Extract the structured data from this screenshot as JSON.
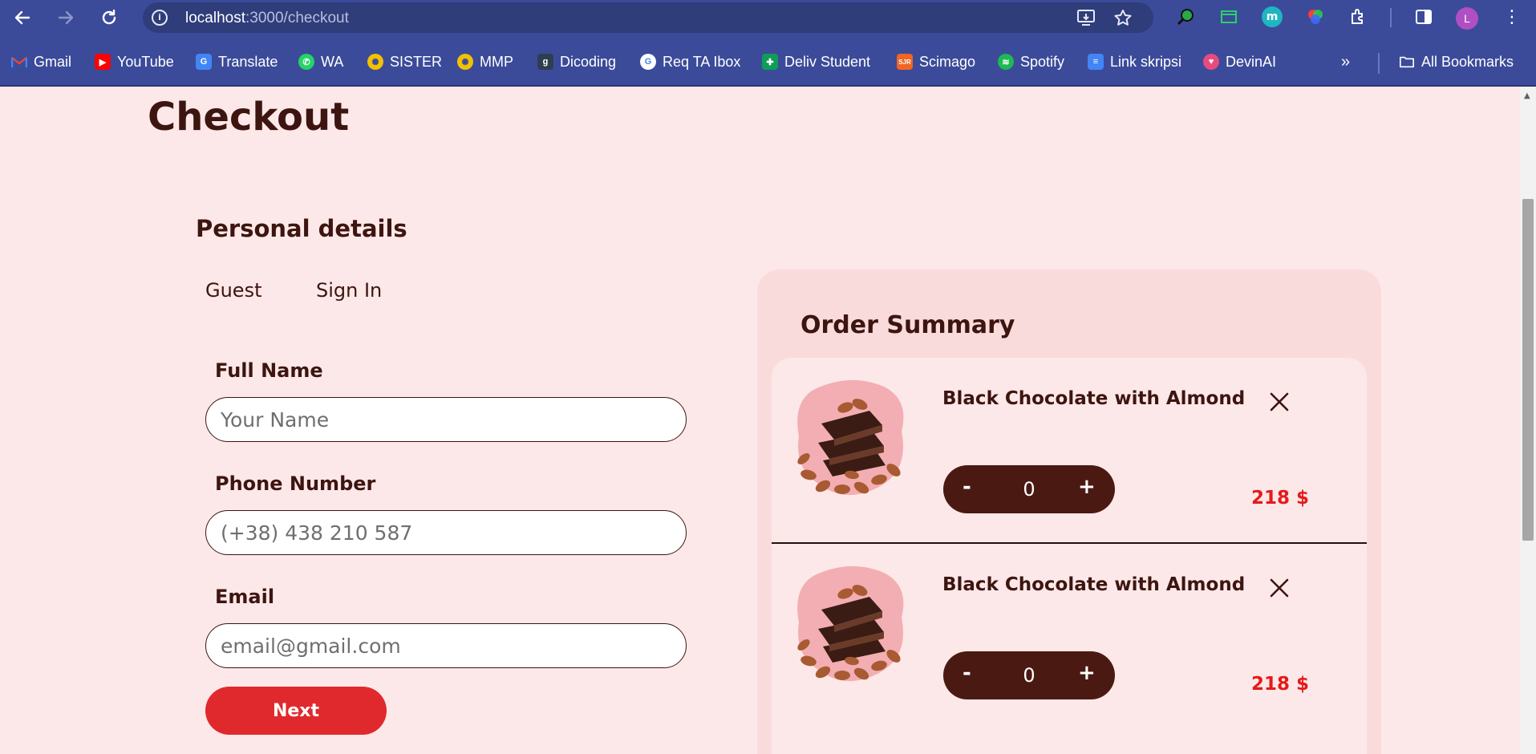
{
  "browser": {
    "url_host": "localhost",
    "url_path": ":3000/checkout",
    "avatar_letter": "L",
    "bookmarks": [
      {
        "label": "Gmail",
        "icon": "gmail-icon",
        "color": "#ea4335"
      },
      {
        "label": "YouTube",
        "icon": "youtube-icon",
        "color": "#ff0000"
      },
      {
        "label": "Translate",
        "icon": "translate-icon",
        "color": "#4285f4"
      },
      {
        "label": "WA",
        "icon": "whatsapp-icon",
        "color": "#25d366"
      },
      {
        "label": "SISTER",
        "icon": "sister-icon",
        "color": "#f2c200"
      },
      {
        "label": "MMP",
        "icon": "mmp-icon",
        "color": "#f2c200"
      },
      {
        "label": "Dicoding",
        "icon": "dicoding-icon",
        "color": "#2d3e50"
      },
      {
        "label": "Req TA Ibox",
        "icon": "google-icon",
        "color": "#ffffff"
      },
      {
        "label": "Deliv Student",
        "icon": "sheets-icon",
        "color": "#0f9d58"
      },
      {
        "label": "Scimago",
        "icon": "scimago-icon",
        "color": "#f26522"
      },
      {
        "label": "Spotify",
        "icon": "spotify-icon",
        "color": "#1db954"
      },
      {
        "label": "Link skripsi",
        "icon": "docs-icon",
        "color": "#4285f4"
      },
      {
        "label": "DevinAI",
        "icon": "devinai-icon",
        "color": "#e84a7f"
      }
    ],
    "all_bookmarks": "All Bookmarks"
  },
  "page": {
    "title": "Checkout",
    "personal_details": "Personal details",
    "tabs": [
      "Guest",
      "Sign In"
    ],
    "fields": [
      {
        "label": "Full Name",
        "placeholder": "Your Name"
      },
      {
        "label": "Phone Number",
        "placeholder": "(+38) 438 210 587"
      },
      {
        "label": "Email",
        "placeholder": "email@gmail.com"
      }
    ],
    "next_label": "Next"
  },
  "order_summary": {
    "title": "Order Summary",
    "items": [
      {
        "name": "Black Chocolate with Almond",
        "quantity": "0",
        "minus": "-",
        "plus": "+",
        "price": "218 $"
      },
      {
        "name": "Black Chocolate with Almond",
        "quantity": "0",
        "minus": "-",
        "plus": "+",
        "price": "218 $"
      }
    ]
  },
  "colors": {
    "background": "#fce8e8",
    "text_dark": "#3d1510",
    "accent_red": "#e0292c",
    "price_red": "#e51a1a",
    "stepper_brown": "#4a1a12"
  }
}
